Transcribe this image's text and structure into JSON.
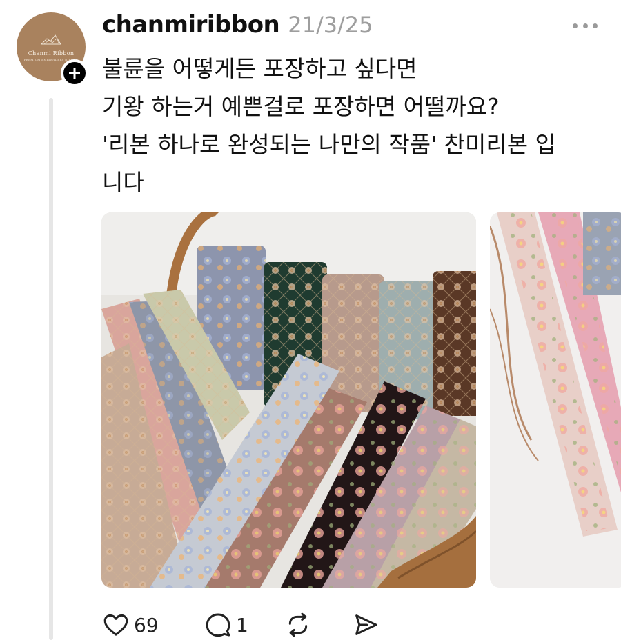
{
  "post": {
    "username": "chanmiribbon",
    "timestamp": "21/3/25",
    "avatar": {
      "brand_text": "Chanmi Ribbon",
      "brand_subtext": "PREMIUM EMBROIDERY RIBBON"
    },
    "lines": [
      "불륜을 어떻게든 포장하고 싶다면",
      "기왕 하는거 예쁜걸로 포장하면 어떨까요?",
      "'리본 하나로 완성되는 나만의 작품' 찬미리본 입",
      "니다"
    ],
    "images": [
      {
        "description_icon": "image-ribbons-basket"
      },
      {
        "description_icon": "image-ribbons-pink"
      }
    ]
  },
  "actions": {
    "like": {
      "icon": "heart-icon",
      "count": "69"
    },
    "reply": {
      "icon": "comment-icon",
      "count": "1"
    },
    "repost": {
      "icon": "repost-icon"
    },
    "share": {
      "icon": "send-icon"
    }
  },
  "colors": {
    "avatar_bg": "#a9825e",
    "muted_text": "#9e9e9e",
    "thread_line": "#e6e6e6"
  }
}
